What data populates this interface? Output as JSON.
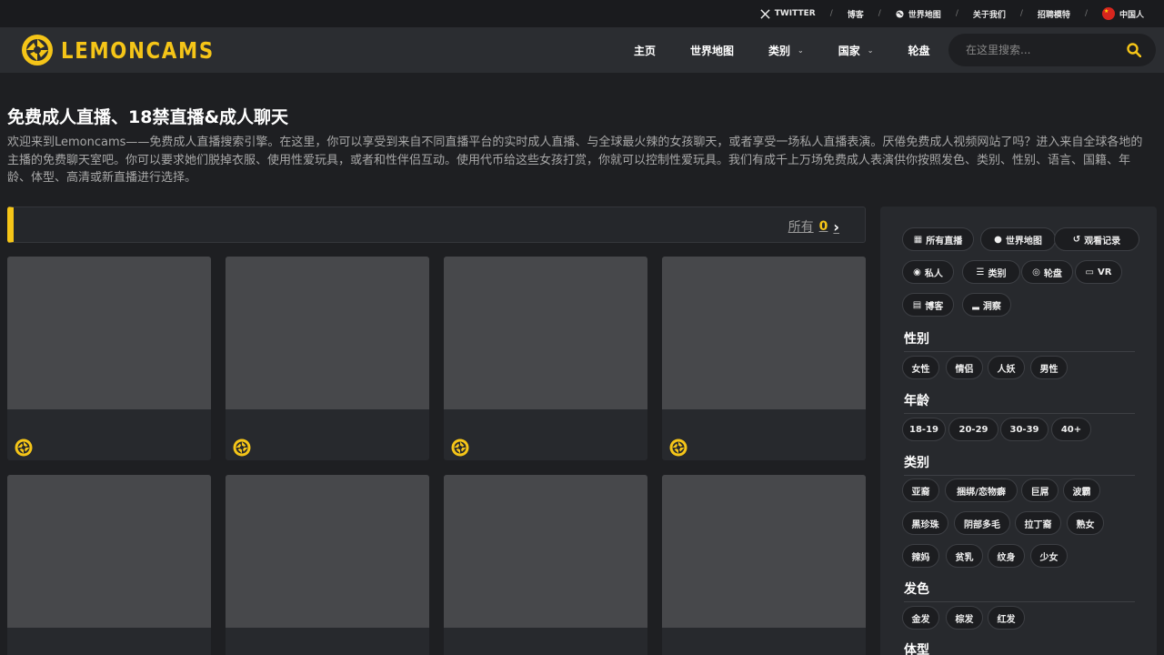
{
  "topbar": {
    "twitter": "TWITTER",
    "blog": "博客",
    "worldmap": "世界地图",
    "about": "关于我们",
    "recruit": "招聘模特",
    "language": "中国人"
  },
  "nav": {
    "logo_text": "LEMONCAMS",
    "home": "主页",
    "worldmap": "世界地图",
    "categories": "类别",
    "countries": "国家",
    "roulette": "轮盘",
    "search_placeholder": "在这里搜索..."
  },
  "main": {
    "headline": "免费成人直播、18禁直播&成人聊天",
    "intro": "欢迎来到Lemoncams——免费成人直播搜索引擎。在这里，你可以享受到来自不同直播平台的实时成人直播、与全球最火辣的女孩聊天，或者享受一场私人直播表演。厌倦免费成人视频网站了吗？进入来自全球各地的主播的免费聊天室吧。你可以要求她们脱掉衣服、使用性爱玩具，或者和性伴侣互动。使用代币给这些女孩打赏，你就可以控制性爱玩具。我们有成千上万场免费成人表演供你按照发色、类别、性别、语言、国籍、年龄、体型、高清或新直播进行选择。",
    "all_label": "所有",
    "all_count": "0",
    "cards": 8
  },
  "sidebar": {
    "quick": [
      "所有直播",
      "世界地图",
      "观看记录",
      "私人",
      "类别",
      "轮盘",
      "VR",
      "博客",
      "洞察"
    ],
    "gender_title": "性别",
    "gender": [
      "女性",
      "情侣",
      "人妖",
      "男性"
    ],
    "age_title": "年龄",
    "age": [
      "18-19",
      "20-29",
      "30-39",
      "40+"
    ],
    "category_title": "类别",
    "category": [
      "亚裔",
      "捆绑/恋物癖",
      "巨屌",
      "波霸",
      "黑珍珠",
      "阴部多毛",
      "拉丁裔",
      "熟女",
      "辣妈",
      "贫乳",
      "纹身",
      "少女"
    ],
    "hair_title": "发色",
    "hair": [
      "金发",
      "棕发",
      "红发"
    ],
    "body_title": "体型"
  },
  "colors": {
    "accent": "#f5c518",
    "background": "#1e1f22",
    "panel": "#27292d"
  }
}
